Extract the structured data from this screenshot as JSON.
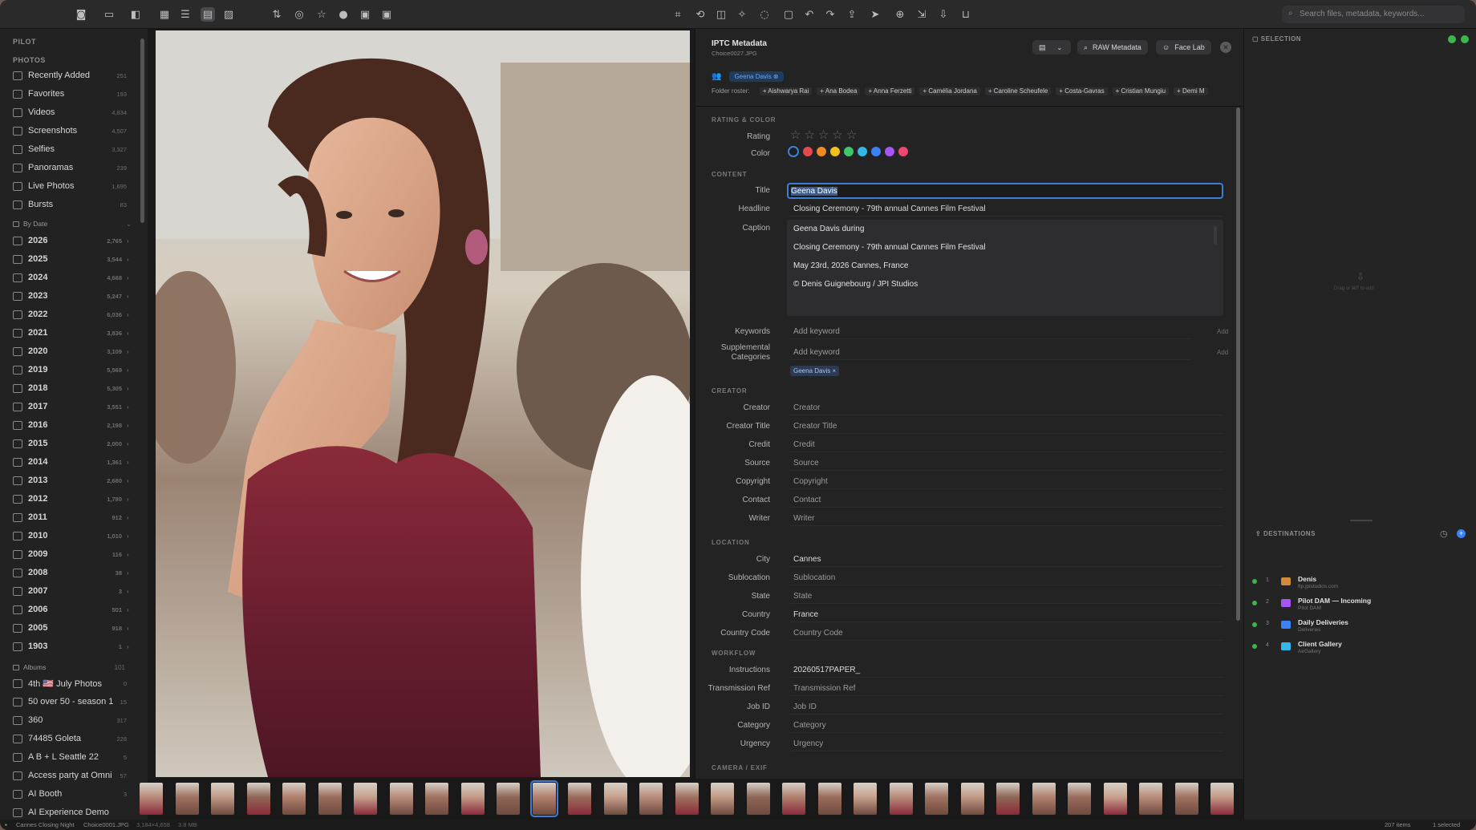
{
  "toolbar": {
    "search_placeholder": "Search files, metadata, keywords..."
  },
  "sidebar": {
    "app_name": "PILOT",
    "section_photos": "PHOTOS",
    "library": [
      {
        "label": "Recently Added",
        "count": "251"
      },
      {
        "label": "Favorites",
        "count": "193"
      },
      {
        "label": "Videos",
        "count": "4,834"
      },
      {
        "label": "Screenshots",
        "count": "4,507"
      },
      {
        "label": "Selfies",
        "count": "3,327"
      },
      {
        "label": "Panoramas",
        "count": "239"
      },
      {
        "label": "Live Photos",
        "count": "1,695"
      },
      {
        "label": "Bursts",
        "count": "83"
      }
    ],
    "by_date_label": "By Date",
    "years": [
      {
        "label": "2026",
        "count": "2,765"
      },
      {
        "label": "2025",
        "count": "3,544"
      },
      {
        "label": "2024",
        "count": "4,668"
      },
      {
        "label": "2023",
        "count": "5,247"
      },
      {
        "label": "2022",
        "count": "6,036"
      },
      {
        "label": "2021",
        "count": "3,836"
      },
      {
        "label": "2020",
        "count": "3,109"
      },
      {
        "label": "2019",
        "count": "5,569"
      },
      {
        "label": "2018",
        "count": "5,305"
      },
      {
        "label": "2017",
        "count": "3,551"
      },
      {
        "label": "2016",
        "count": "2,198"
      },
      {
        "label": "2015",
        "count": "2,000"
      },
      {
        "label": "2014",
        "count": "1,361"
      },
      {
        "label": "2013",
        "count": "2,680"
      },
      {
        "label": "2012",
        "count": "1,780"
      },
      {
        "label": "2011",
        "count": "912"
      },
      {
        "label": "2010",
        "count": "1,010"
      },
      {
        "label": "2009",
        "count": "116"
      },
      {
        "label": "2008",
        "count": "38"
      },
      {
        "label": "2007",
        "count": "3"
      },
      {
        "label": "2006",
        "count": "501"
      },
      {
        "label": "2005",
        "count": "918"
      },
      {
        "label": "1903",
        "count": "1"
      }
    ],
    "albums_label": "Albums",
    "albums_count": "101",
    "albums": [
      {
        "label": "4th 🇺🇸 July Photos",
        "count": "0"
      },
      {
        "label": "50 over 50 - season 1",
        "count": "15"
      },
      {
        "label": "360",
        "count": "317"
      },
      {
        "label": "74485 Goleta",
        "count": "228"
      },
      {
        "label": "A B + L Seattle 22",
        "count": "5"
      },
      {
        "label": "Access party at Omni",
        "count": "57"
      },
      {
        "label": "AI Booth",
        "count": "3"
      },
      {
        "label": "AI Experience Demo",
        "count": ""
      }
    ]
  },
  "panel": {
    "title": "IPTC Metadata",
    "filename": "Choice0027.JPG",
    "raw_button": "RAW Metadata",
    "face_button": "Face Lab",
    "face_tag": "Geena Davis",
    "roster_label": "Folder roster:",
    "roster": [
      "+ Aishwarya Rai",
      "+ Ana Bodea",
      "+ Anna Ferzetti",
      "+ Camélia Jordana",
      "+ Caroline Scheufele",
      "+ Costa-Gavras",
      "+ Cristian Mungiu",
      "+ Demi M"
    ],
    "sec_rating": "RATING & COLOR",
    "rating_label": "Rating",
    "rating_value": 0,
    "color_label": "Color",
    "color_swatches": [
      "#1f1f22",
      "#e5484d",
      "#f08a24",
      "#f1c21b",
      "#3fc56b",
      "#33b7e6",
      "#3b82f6",
      "#a855f7",
      "#ef476f"
    ],
    "sec_content": "CONTENT",
    "title_label": "Title",
    "title_value": "Geena Davis",
    "headline_label": "Headline",
    "headline_value": "Closing Ceremony - 79th annual Cannes Film Festival",
    "caption_label": "Caption",
    "caption_lines": [
      "Geena Davis during",
      "Closing Ceremony - 79th annual Cannes Film Festival",
      "May 23rd, 2026 Cannes, France",
      "© Denis Guignebourg / JPI Studios"
    ],
    "keywords_label": "Keywords",
    "keywords_placeholder": "Add keyword",
    "add_label": "Add",
    "supp_label": "Supplemental Categories",
    "supp_placeholder": "Add keyword",
    "supp_tag": "Geena Davis ×",
    "sec_creator": "CREATOR",
    "creator_fields": [
      {
        "label": "Creator",
        "value": "Creator"
      },
      {
        "label": "Creator Title",
        "value": "Creator Title"
      },
      {
        "label": "Credit",
        "value": "Credit"
      },
      {
        "label": "Source",
        "value": "Source"
      },
      {
        "label": "Copyright",
        "value": "Copyright"
      },
      {
        "label": "Contact",
        "value": "Contact"
      },
      {
        "label": "Writer",
        "value": "Writer"
      }
    ],
    "sec_location": "LOCATION",
    "location_fields": [
      {
        "label": "City",
        "value": "Cannes",
        "filled": true
      },
      {
        "label": "Sublocation",
        "value": "Sublocation",
        "filled": false
      },
      {
        "label": "State",
        "value": "State",
        "filled": false
      },
      {
        "label": "Country",
        "value": "France",
        "filled": true
      },
      {
        "label": "Country Code",
        "value": "Country Code",
        "filled": false
      }
    ],
    "sec_workflow": "WORKFLOW",
    "workflow_fields": [
      {
        "label": "Instructions",
        "value": "20260517PAPER_",
        "filled": true
      },
      {
        "label": "Transmission Ref",
        "value": "Transmission Ref",
        "filled": false
      },
      {
        "label": "Job ID",
        "value": "Job ID",
        "filled": false
      },
      {
        "label": "Category",
        "value": "Category",
        "filled": false
      },
      {
        "label": "Urgency",
        "value": "Urgency",
        "filled": false
      }
    ],
    "sec_camera": "CAMERA / EXIF"
  },
  "right": {
    "selection_label": "SELECTION",
    "drop_hint": "Drag or ⌘F to add",
    "destinations_label": "DESTINATIONS",
    "destinations": [
      {
        "num": "1",
        "name": "Denis",
        "sub": "ftp.jpistudios.com",
        "color": "#d08a3a"
      },
      {
        "num": "2",
        "name": "Pilot DAM — Incoming",
        "sub": "Pilot DAM",
        "color": "#a855f7"
      },
      {
        "num": "3",
        "name": "Daily Deliveries",
        "sub": "Deliveries",
        "color": "#3b82f6"
      },
      {
        "num": "4",
        "name": "Client Gallery",
        "sub": "AirGallery",
        "color": "#33b7e6"
      }
    ]
  },
  "status": {
    "album": "Cannes Closing Night",
    "file": "Choice0001.JPG",
    "dims": "3,184×4,658",
    "size": "3.8 MB",
    "items": "207 items",
    "selected": "1 selected"
  }
}
